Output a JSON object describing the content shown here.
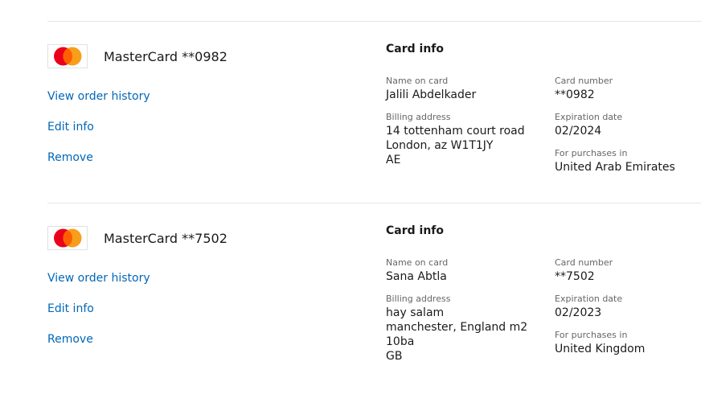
{
  "cards": [
    {
      "title": "MasterCard **0982",
      "brand_icon": "mastercard-logo",
      "links": {
        "view_order_history": "View order history",
        "edit_info": "Edit info",
        "remove": "Remove"
      },
      "info": {
        "heading": "Card info",
        "name_label": "Name on card",
        "name_value": "Jalili Abdelkader",
        "billing_label": "Billing address",
        "billing_lines": [
          "14 tottenham court road",
          "London, az W1T1JY",
          "AE"
        ],
        "number_label": "Card number",
        "number_value": "**0982",
        "expiry_label": "Expiration date",
        "expiry_value": "02/2024",
        "purchases_label": "For purchases in",
        "purchases_value": "United Arab Emirates"
      }
    },
    {
      "title": "MasterCard **7502",
      "brand_icon": "mastercard-logo",
      "links": {
        "view_order_history": "View order history",
        "edit_info": "Edit info",
        "remove": "Remove"
      },
      "info": {
        "heading": "Card info",
        "name_label": "Name on card",
        "name_value": "Sana Abtla",
        "billing_label": "Billing address",
        "billing_lines": [
          "hay salam",
          "manchester, England m2",
          "10ba",
          "GB"
        ],
        "number_label": "Card number",
        "number_value": "**7502",
        "expiry_label": "Expiration date",
        "expiry_value": "02/2023",
        "purchases_label": "For purchases in",
        "purchases_value": "United Kingdom"
      }
    }
  ],
  "colors": {
    "link": "#0067b8",
    "mc_red": "#eb001b",
    "mc_orange": "#f79e1b",
    "mc_overlap": "#ff5f00"
  }
}
